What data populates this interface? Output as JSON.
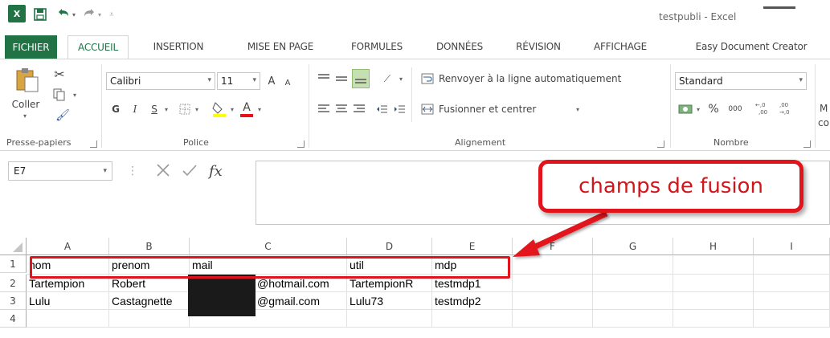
{
  "window": {
    "title": "testpubli - Excel"
  },
  "tabs": [
    "FICHIER",
    "ACCUEIL",
    "INSERTION",
    "MISE EN PAGE",
    "FORMULES",
    "DONNÉES",
    "RÉVISION",
    "AFFICHAGE",
    "Easy Document Creator"
  ],
  "ribbon": {
    "clipboard": {
      "paste_label": "Coller",
      "group_label": "Presse-papiers"
    },
    "font": {
      "font_name": "Calibri",
      "font_size": "11",
      "bold": "G",
      "italic": "I",
      "underline": "S",
      "group_label": "Police",
      "grow": "A",
      "shrink": "A",
      "color_letter": "A"
    },
    "alignment": {
      "wrap_label": "Renvoyer à la ligne automatiquement",
      "merge_label": "Fusionner et centrer",
      "group_label": "Alignement"
    },
    "number": {
      "format": "Standard",
      "percent": "%",
      "thousands": "000",
      "inc_dec": ",0 ,00",
      "dec_dec": ",00 ,0",
      "group_label": "Nombre"
    },
    "cut_extra": {
      "line1": "M",
      "line2": "co"
    }
  },
  "formula_bar": {
    "name_box": "E7",
    "fx": "fx",
    "value": ""
  },
  "sheet": {
    "columns": [
      "A",
      "B",
      "C",
      "D",
      "E",
      "F",
      "G",
      "H",
      "I"
    ],
    "rows": [
      [
        "nom",
        "prenom",
        "mail",
        "util",
        "mdp"
      ],
      [
        "Tartempion",
        "Robert",
        "@hotmail.com",
        "TartempionR",
        "testmdp1"
      ],
      [
        "Lulu",
        "Castagnette",
        "@gmail.com",
        "Lulu73",
        "testmdp2"
      ],
      [
        "",
        "",
        "",
        "",
        ""
      ]
    ],
    "row_numbers": [
      "1",
      "2",
      "3",
      "4"
    ]
  },
  "annotation": {
    "callout_text": "champs de fusion"
  },
  "colors": {
    "excel_green": "#217346",
    "annotation_red": "#e2131b"
  }
}
